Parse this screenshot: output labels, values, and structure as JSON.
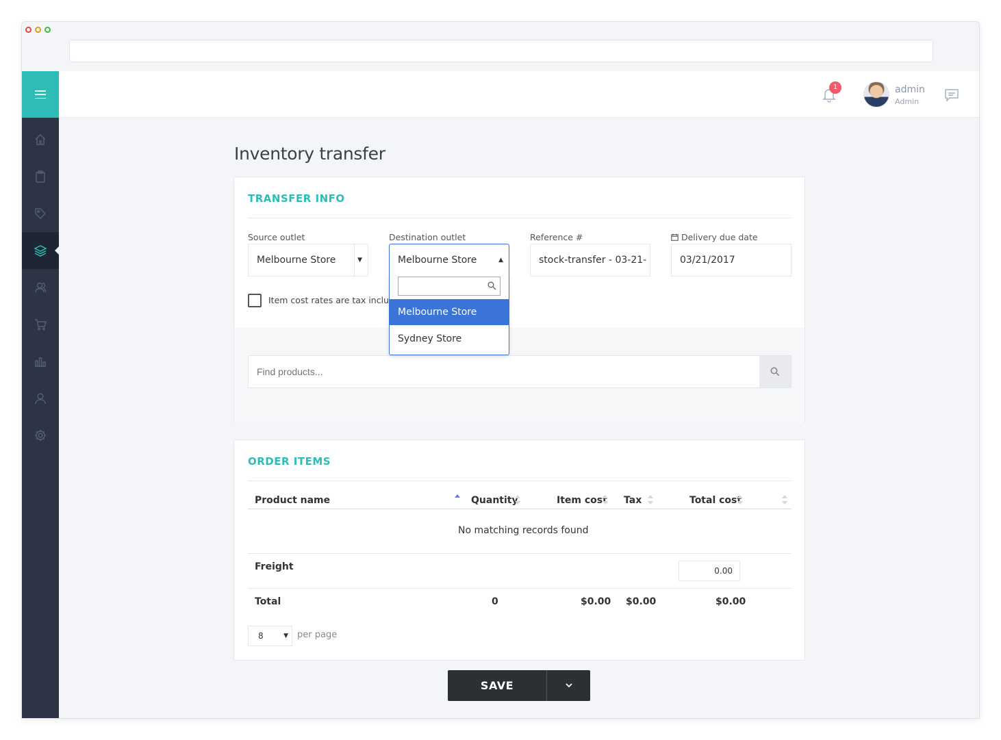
{
  "header": {
    "user_name": "admin",
    "user_role": "Admin",
    "notification_count": "1"
  },
  "page": {
    "title": "Inventory transfer"
  },
  "transfer_info": {
    "title": "TRANSFER INFO",
    "source_label": "Source outlet",
    "source_value": "Melbourne Store",
    "destination_label": "Destination outlet",
    "destination_value": "Melbourne Store",
    "reference_label": "Reference #",
    "reference_value": "stock-transfer - 03-21-",
    "due_date_label": "Delivery due date",
    "due_date_value": "03/21/2017",
    "tax_checkbox_label": "Item cost rates are tax inclusive",
    "destination_options": [
      "Melbourne Store",
      "Sydney Store"
    ],
    "destination_selected": "Melbourne Store"
  },
  "product_search": {
    "placeholder": "Find products..."
  },
  "order_items": {
    "title": "ORDER ITEMS",
    "columns": [
      "Product name",
      "Quantity",
      "Item cost",
      "Tax",
      "Total cost"
    ],
    "empty_message": "No matching records found",
    "freight_label": "Freight",
    "freight_value": "0.00",
    "total_label": "Total",
    "total_quantity": "0",
    "total_item_cost": "$0.00",
    "total_tax": "$0.00",
    "total_cost": "$0.00",
    "per_page_value": "8",
    "per_page_label": "per page"
  },
  "actions": {
    "save_label": "SAVE"
  },
  "colors": {
    "accent": "#2dbdb6",
    "sidebar": "#2c3445",
    "selection": "#3a74d8",
    "badge": "#f05a6a"
  },
  "icons": [
    "home-icon",
    "clipboard-icon",
    "tag-icon",
    "layers-icon",
    "users-icon",
    "cart-icon",
    "chart-icon",
    "user-icon",
    "gear-icon",
    "bell-icon",
    "chat-icon",
    "search-icon",
    "calendar-icon",
    "chevron-down-icon"
  ]
}
